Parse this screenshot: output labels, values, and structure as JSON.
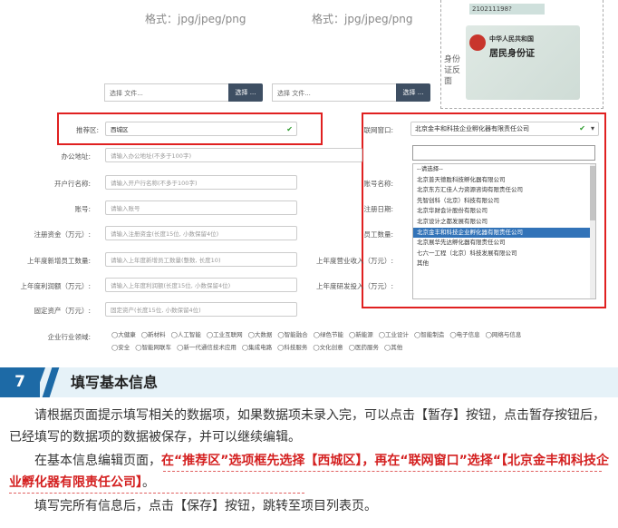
{
  "upload": {
    "format_hint_1": "格式：jpg/jpeg/png",
    "format_hint_2": "格式：jpg/jpeg/png",
    "choose_file_placeholder": "选择 文件...",
    "choose_button": "选择 ...",
    "id_label": "身份证反面",
    "id_card_title_small": "中华人民共和国",
    "id_card_title": "居民身份证",
    "id_number_fragment": "210211198?"
  },
  "form": {
    "recommend_label": "推荐区:",
    "recommend_value": "西城区",
    "office_label": "办公地址:",
    "office_placeholder": "请输入办公地址(不多于100字)",
    "bank_label": "开户行名称:",
    "bank_placeholder": "请输入开户行名称(不多于100字)",
    "account_label": "账号:",
    "account_placeholder": "请输入账号",
    "capital_label": "注册资金（万元）:",
    "capital_placeholder": "请输入注册资金(长度15位, 小数保留4位)",
    "new_staff_label": "上年度新增员工数量:",
    "new_staff_placeholder": "请输入上年度新增员工数量(整数, 长度10)",
    "profit_label": "上年度利润额（万元）:",
    "profit_placeholder": "请输入上年度利润额(长度15位, 小数保留4位)",
    "assets_label": "固定资产（万元）:",
    "assets_placeholder": "固定资产(长度15位, 小数保留4位)",
    "industry_label": "企业行业领域:",
    "network_label": "联网窗口:",
    "network_value": "北京金丰和科技企业孵化器有限责任公司",
    "right_labels": [
      "账号名称:",
      "注册日期:",
      "员工数量:",
      "上年度营业收入（万元）:",
      "上年度研发投入（万元）:"
    ],
    "industry_row1": [
      "大健康",
      "新材料",
      "人工智能",
      "工业互联网",
      "大数据",
      "智能融合",
      "绿色节能",
      "新能源",
      "工业设计",
      "智能制造",
      "电子信息",
      "网络与信息"
    ],
    "industry_row2": [
      "安全",
      "智能网联车",
      "新一代通信技术应用",
      "集成电路",
      "科技服务",
      "文化创意",
      "医药服务",
      "其他"
    ]
  },
  "dropdown": {
    "items": [
      "--请选择--",
      "北京普天德胜科技孵化器有限公司",
      "北京东方汇佳人力资源咨询有限责任公司",
      "先智创科（北京）科技有限公司",
      "北京华财会计股份有限公司",
      "北京设计之都发展有限公司",
      "北京金丰和科技企业孵化器有限责任公司",
      "北京展华先达孵化器有限责任公司",
      "七六一工程（北京）科技发展有限公司",
      "其他"
    ],
    "highlighted_index": 6
  },
  "section": {
    "number": "7",
    "title": "填写基本信息"
  },
  "instructions": {
    "p1": "请根据页面提示填写相关的数据项，如果数据项未录入完，可以点击【暂存】按钮，点击暂存按钮后，已经填写的数据项的数据被保存，并可以继续编辑。",
    "p2_plain": "在基本信息编辑页面，",
    "p2_highlight": "在“推荐区”选项框先选择【西城区】，再在“联网窗口”选择“【北京金丰和科技企业孵化器有限责任公司】",
    "p2_end": "。",
    "p3": "填写完所有信息后，点击【保存】按钮，跳转至项目列表页。"
  },
  "colors": {
    "accent_blue": "#1d6aa6",
    "highlight_red": "#d42020",
    "select_highlight": "#3273b8"
  }
}
